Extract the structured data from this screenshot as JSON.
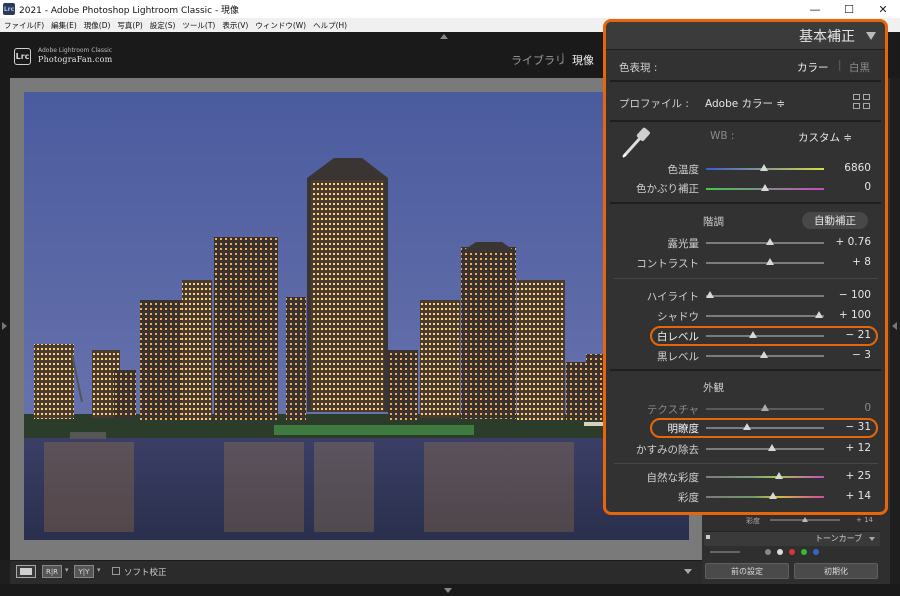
{
  "window": {
    "title": "2021 - Adobe Photoshop Lightroom Classic - 現像",
    "app_icon_text": "Lrc",
    "minimize": "—",
    "maximize": "☐",
    "close": "✕"
  },
  "menu": [
    "ファイル(F)",
    "編集(E)",
    "現像(D)",
    "写真(P)",
    "設定(S)",
    "ツール(T)",
    "表示(V)",
    "ウィンドウ(W)",
    "ヘルプ(H)"
  ],
  "brand": {
    "logo_text": "Lrc",
    "line1": "Adobe Lightroom Classic",
    "line2": "PhotograFan.com"
  },
  "modules": {
    "library": "ライブラリ",
    "separator": "|",
    "develop": "現像"
  },
  "toolbar": {
    "before_after_1": "R|R",
    "before_after_2": "Y|Y",
    "chevron": "▾",
    "soft_proof": "ソフト校正"
  },
  "under_panel": {
    "saturation_label": "彩度",
    "saturation_value": "+ 14",
    "saturation_level": 0.5,
    "tone_curve": "トーンカーブ",
    "prev_settings": "前の設定",
    "reset": "初期化"
  },
  "basic": {
    "title": "基本補正",
    "treatment": {
      "label": "色表現 :",
      "color": "カラー",
      "bw": "白黒"
    },
    "profile": {
      "label": "プロファイル :",
      "value": "Adobe カラー ≑"
    },
    "wb": {
      "label": "WB :",
      "value": "カスタム ≑"
    },
    "tone_header": "階調",
    "auto": "自動補正",
    "presence_header": "外観",
    "sliders": {
      "temp": {
        "label": "色温度",
        "value": "6860",
        "level": 0.49
      },
      "tint": {
        "label": "色かぶり補正",
        "value": "0",
        "level": 0.5
      },
      "exposure": {
        "label": "露光量",
        "value": "+ 0.76",
        "level": 0.54
      },
      "contrast": {
        "label": "コントラスト",
        "value": "+ 8",
        "level": 0.54
      },
      "highlights": {
        "label": "ハイライト",
        "value": "− 100",
        "level": 0.03
      },
      "shadows": {
        "label": "シャドウ",
        "value": "+ 100",
        "level": 0.96
      },
      "whites": {
        "label": "白レベル",
        "value": "− 21",
        "level": 0.4
      },
      "blacks": {
        "label": "黒レベル",
        "value": "− 3",
        "level": 0.49
      },
      "texture": {
        "label": "テクスチャ",
        "value": "0",
        "level": 0.5
      },
      "clarity": {
        "label": "明瞭度",
        "value": "− 31",
        "level": 0.35
      },
      "dehaze": {
        "label": "かすみの除去",
        "value": "+ 12",
        "level": 0.56
      },
      "vibrance": {
        "label": "自然な彩度",
        "value": "+ 25",
        "level": 0.62
      },
      "saturation": {
        "label": "彩度",
        "value": "+ 14",
        "level": 0.57
      }
    }
  },
  "colors": {
    "accent": "#e8660b",
    "panel": "#323232",
    "sky_top": "#4d5ea0",
    "sky_bottom": "#6e78b0",
    "water": "#2a3050"
  }
}
